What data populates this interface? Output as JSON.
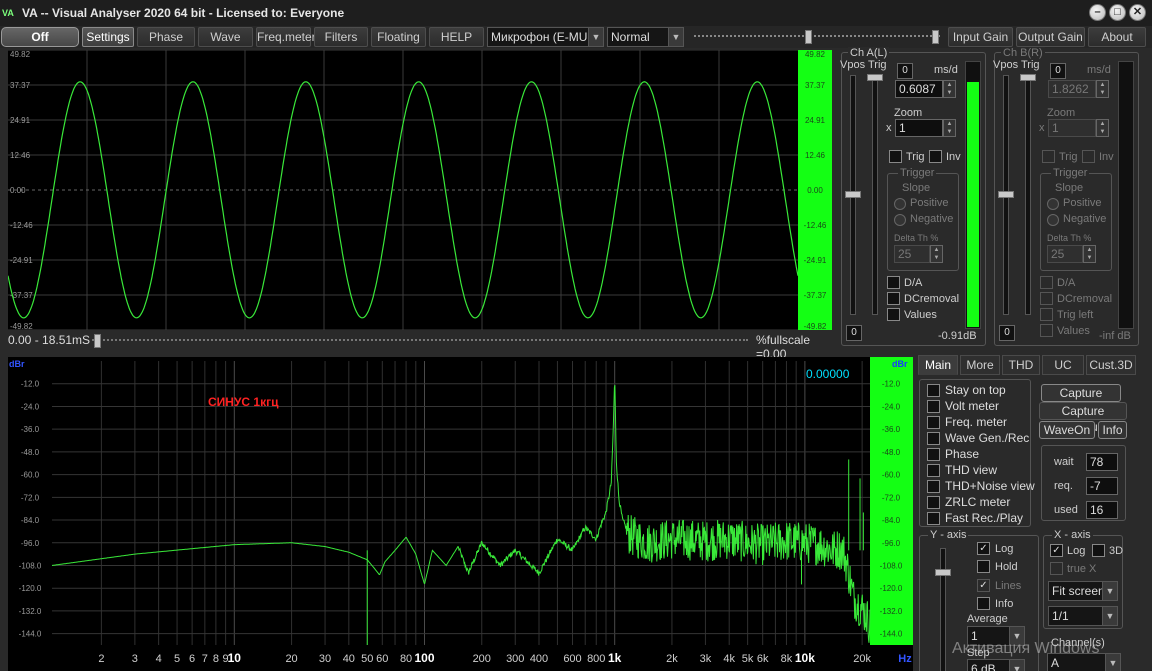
{
  "window": {
    "title": "VA -- Visual Analyser 2020 64 bit - Licensed to: Everyone",
    "logo": "VA",
    "controls": {
      "minimize": "–",
      "maximize": "□",
      "close": "✕"
    }
  },
  "toolbar": {
    "off": "Off",
    "settings": "Settings",
    "phase": "Phase",
    "wave": "Wave",
    "freqmeter": "Freq.meter",
    "filters": "Filters",
    "floating": "Floating",
    "help": "HELP",
    "input_device": "Микрофон (E-MU T",
    "mode": "Normal",
    "input_gain": "Input Gain",
    "output_gain": "Output Gain",
    "about": "About",
    "dropdown_arrow": "▼"
  },
  "scope": {
    "y_ticks": [
      "49.82",
      "37.37",
      "24.91",
      "12.46",
      "0.00",
      "-12.46",
      "-24.91",
      "-37.37",
      "-49.82"
    ],
    "range": "0.00 - 18.51mS",
    "fullscale": "%fullscale =0.00",
    "chart_data": {
      "type": "line",
      "title": "",
      "xlabel": "",
      "ylabel": "",
      "xlim": [
        0,
        18.51
      ],
      "ylim": [
        -49.82,
        49.82
      ],
      "series": [
        {
          "name": "",
          "frequency_khz": 1,
          "amplitude": 42,
          "offset": -3.5,
          "cycles": 7,
          "phase_deg": 220
        }
      ]
    }
  },
  "ch_a": {
    "title": "Ch A(L)",
    "vpos": "Vpos",
    "trig": "Trig",
    "trig_level": "0",
    "msd_label": "ms/d",
    "msd_value": "0.6087",
    "zoom_label": "Zoom",
    "zoom_x": "x",
    "zoom_value": "1",
    "trig_check": "Trig",
    "inv_check": "Inv",
    "trigger_group": "Trigger",
    "slope": "Slope",
    "positive": "Positive",
    "negative": "Negative",
    "delta_th": "Delta Th %",
    "delta_value": "25",
    "da": "D/A",
    "dc_removal": "DCremoval",
    "values": "Values",
    "vpos_value": "0",
    "level_db": "-0.91dB",
    "level_fraction": 0.92
  },
  "ch_b": {
    "title": "Ch B(R)",
    "vpos": "Vpos",
    "trig": "Trig",
    "trig_level": "0",
    "msd_label": "ms/d",
    "msd_value": "1.8262",
    "zoom_label": "Zoom",
    "zoom_x": "x",
    "zoom_value": "1",
    "trig_check": "Trig",
    "inv_check": "Inv",
    "trigger_group": "Trigger",
    "slope": "Slope",
    "positive": "Positive",
    "negative": "Negative",
    "delta_th": "Delta Th %",
    "delta_value": "25",
    "da": "D/A",
    "dc_removal": "DCremoval",
    "trig_left": "Trig left",
    "values": "Values",
    "vpos_value": "0",
    "level_db": "-inf dB"
  },
  "spectrum": {
    "unit_left": "dBr",
    "unit_right": "dBr",
    "hz_label": "Hz",
    "y_ticks": [
      "-12.0",
      "-24.0",
      "-36.0",
      "-48.0",
      "-60.0",
      "-72.0",
      "-84.0",
      "-96.0",
      "-108.0",
      "-120.0",
      "-132.0",
      "-144.0"
    ],
    "x_ticks": [
      {
        "f": 2,
        "label": "2"
      },
      {
        "f": 3,
        "label": "3"
      },
      {
        "f": 4,
        "label": "4"
      },
      {
        "f": 5,
        "label": "5"
      },
      {
        "f": 6,
        "label": "6"
      },
      {
        "f": 7,
        "label": "7"
      },
      {
        "f": 8,
        "label": "8"
      },
      {
        "f": 9,
        "label": "9"
      },
      {
        "f": 10,
        "label": "10",
        "bold": true
      },
      {
        "f": 20,
        "label": "20"
      },
      {
        "f": 30,
        "label": "30"
      },
      {
        "f": 40,
        "label": "40"
      },
      {
        "f": 50,
        "label": "50"
      },
      {
        "f": 60,
        "label": "60"
      },
      {
        "f": 80,
        "label": "80"
      },
      {
        "f": 100,
        "label": "100",
        "bold": true
      },
      {
        "f": 200,
        "label": "200"
      },
      {
        "f": 300,
        "label": "300"
      },
      {
        "f": 400,
        "label": "400"
      },
      {
        "f": 600,
        "label": "600"
      },
      {
        "f": 800,
        "label": "800"
      },
      {
        "f": 1000,
        "label": "1k",
        "bold": true
      },
      {
        "f": 2000,
        "label": "2k"
      },
      {
        "f": 3000,
        "label": "3k"
      },
      {
        "f": 4000,
        "label": "4k"
      },
      {
        "f": 5000,
        "label": "5k"
      },
      {
        "f": 6000,
        "label": "6k"
      },
      {
        "f": 8000,
        "label": "8k"
      },
      {
        "f": 10000,
        "label": "10k",
        "bold": true
      },
      {
        "f": 20000,
        "label": "20k"
      }
    ],
    "annotation": "СИНУС 1кгц",
    "readout": "0.00000",
    "chart_data": {
      "type": "line",
      "title": "",
      "xlabel": "",
      "ylabel": "",
      "x_scale": "log",
      "xlim": [
        1.1,
        22000
      ],
      "ylim": [
        -150,
        0
      ],
      "series": [
        {
          "name": "",
          "x": [
            1.1,
            3,
            10,
            20,
            30,
            40,
            50,
            55,
            58,
            62,
            70,
            80,
            90,
            100,
            110,
            130,
            150,
            170,
            200,
            250,
            300,
            400,
            500,
            600,
            700,
            800,
            850,
            900,
            930,
            960,
            980,
            1000,
            1020,
            1050,
            1100,
            1200,
            1500,
            2000,
            3000,
            4000,
            5000,
            6000,
            8000,
            10000,
            12000,
            14000,
            15000,
            16000,
            17000,
            18000,
            19000,
            20000,
            21000,
            22000
          ],
          "y": [
            -108,
            -102,
            -97,
            -96,
            -98,
            -101,
            -105,
            -110,
            -113,
            -106,
            -100,
            -93,
            -102,
            -118,
            -100,
            -108,
            -98,
            -112,
            -96,
            -108,
            -100,
            -112,
            -94,
            -100,
            -88,
            -94,
            -86,
            -80,
            -72,
            -64,
            -40,
            -8,
            -52,
            -72,
            -84,
            -92,
            -96,
            -94,
            -95,
            -94,
            -96,
            -97,
            -95,
            -96,
            -97,
            -100,
            -99,
            -101,
            -112,
            -125,
            -128,
            -131,
            -134,
            -140
          ]
        }
      ],
      "spikes": [
        {
          "x": 17000,
          "y": -52
        },
        {
          "x": 19500,
          "y": -62
        },
        {
          "x": 20300,
          "y": -80
        },
        {
          "x": 50,
          "y": -150
        },
        {
          "x": 9600,
          "y": -118
        }
      ]
    }
  },
  "panel": {
    "tabs": [
      "Main",
      "More",
      "THD",
      "UC",
      "Cust.3D"
    ],
    "options": [
      "Stay on top",
      "Volt meter",
      "Freq. meter",
      "Wave Gen./Rec",
      "Phase",
      "THD view",
      "THD+Noise view",
      "ZRLC meter",
      "Fast Rec./Play"
    ],
    "capture_scope": "Capture scope",
    "capture_spectrum": "Capture spectrum",
    "waveon": "WaveOn",
    "info": "Info",
    "wait_label": "wait",
    "wait_value": "78",
    "req_label": "req.",
    "req_value": "-7",
    "used_label": "used",
    "used_value": "16",
    "y_axis": "Y - axis",
    "x_axis": "X - axis",
    "log": "Log",
    "hold": "Hold",
    "lines": "Lines",
    "y_info": "Info",
    "average": "Average",
    "average_value": "1",
    "step": "Step",
    "step_value": "6 dB",
    "x_log": "Log",
    "three_d": "3D",
    "true_x": "true X",
    "fit_screen": "Fit screen",
    "ratio": "1/1",
    "channels": "Channel(s)",
    "channel_value": "A"
  },
  "watermark": "Активация Windows",
  "colors": {
    "trace": "#39e839",
    "scale_bg": "#14ff14",
    "grid": "#3a3a3a",
    "annotation": "#ff2222",
    "readout": "#00e0ff"
  }
}
